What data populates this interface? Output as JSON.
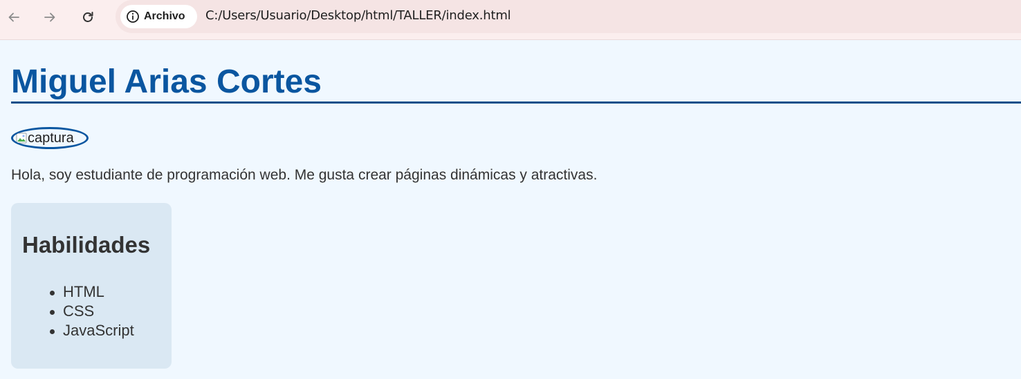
{
  "browser": {
    "security_chip_label": "Archivo",
    "url": "C:/Users/Usuario/Desktop/html/TALLER/index.html"
  },
  "page": {
    "title": "Miguel Arias Cortes",
    "profile_image_alt": "captura",
    "intro": "Hola, soy estudiante de programación web. Me gusta crear páginas dinámicas y atractivas.",
    "skills": {
      "heading": "Habilidades",
      "items": [
        "HTML",
        "CSS",
        "JavaScript"
      ]
    }
  },
  "colors": {
    "page_background": "#f0f8ff",
    "title_blue": "#0a56a0",
    "card_background": "#dae8f3",
    "toolbar_background": "#fbeeee"
  }
}
